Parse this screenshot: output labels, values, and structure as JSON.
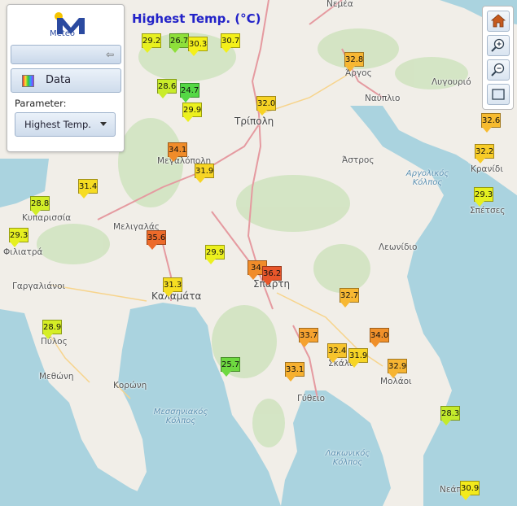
{
  "map": {
    "title": "Highest Temp. (°C)"
  },
  "panel": {
    "logo_text": "Meteo",
    "data_label": "Data",
    "parameter_label": "Parameter:",
    "parameter_value": "Highest Temp."
  },
  "places": [
    {
      "id": "nemea",
      "label": "Νεμέα"
    },
    {
      "id": "argos",
      "label": "Άργος"
    },
    {
      "id": "nafplio",
      "label": "Ναύπλιο"
    },
    {
      "id": "lygourio",
      "label": "Λυγουριό"
    },
    {
      "id": "tripoli",
      "label": "Τρίπολη"
    },
    {
      "id": "astros",
      "label": "Άστρος"
    },
    {
      "id": "megalopoli",
      "label": "Μεγαλόπολη"
    },
    {
      "id": "kyparissia",
      "label": "Κυπαρισσία"
    },
    {
      "id": "meligalas",
      "label": "Μελιγαλάς"
    },
    {
      "id": "filiatra",
      "label": "Φιλιατρά"
    },
    {
      "id": "gargalianoi",
      "label": "Γαργαλιάνοι"
    },
    {
      "id": "kalamata",
      "label": "Καλαμάτα"
    },
    {
      "id": "sparti",
      "label": "Σπάρτη"
    },
    {
      "id": "leonidio",
      "label": "Λεωνίδιο"
    },
    {
      "id": "pylos",
      "label": "Πύλος"
    },
    {
      "id": "methoni",
      "label": "Μεθώνη"
    },
    {
      "id": "koroni",
      "label": "Κορώνη"
    },
    {
      "id": "skala",
      "label": "Σκάλα"
    },
    {
      "id": "molaoi",
      "label": "Μολάοι"
    },
    {
      "id": "gytheio",
      "label": "Γύθειο"
    },
    {
      "id": "kranidi",
      "label": "Κρανίδι"
    },
    {
      "id": "spetses",
      "label": "Σπέτσες"
    },
    {
      "id": "neapoli",
      "label": "Νεάπ"
    },
    {
      "id": "argolikos",
      "label": "Αργολικός Κόλπος"
    },
    {
      "id": "messiniakos",
      "label": "Μεσσηνιακός Κόλπος"
    },
    {
      "id": "lakonikos",
      "label": "Λακωνικός Κόλπος"
    }
  ],
  "markers": [
    {
      "value": "29.2",
      "color": "#e8f020"
    },
    {
      "value": "26.7",
      "color": "#8ee03a"
    },
    {
      "value": "30.3",
      "color": "#f4f01a"
    },
    {
      "value": "30.7",
      "color": "#f4f01a"
    },
    {
      "value": "32.8",
      "color": "#f7b733"
    },
    {
      "value": "28.6",
      "color": "#c9ec2a"
    },
    {
      "value": "24.7",
      "color": "#55d845"
    },
    {
      "value": "29.9",
      "color": "#ecf01e"
    },
    {
      "value": "32.0",
      "color": "#f7d325"
    },
    {
      "value": "32.6",
      "color": "#f7bb30"
    },
    {
      "value": "34.1",
      "color": "#f08c2a"
    },
    {
      "value": "32.2",
      "color": "#f7cc28"
    },
    {
      "value": "31.9",
      "color": "#f7d525"
    },
    {
      "value": "31.4",
      "color": "#f6dc22"
    },
    {
      "value": "28.8",
      "color": "#d2ee28"
    },
    {
      "value": "29.3",
      "color": "#e6f020"
    },
    {
      "value": "29.3",
      "color": "#e6f020"
    },
    {
      "value": "35.6",
      "color": "#ec6a2a"
    },
    {
      "value": "29.9",
      "color": "#ecf01e"
    },
    {
      "value": "31.3",
      "color": "#f6de22"
    },
    {
      "value": "34.",
      "color": "#f08c2a"
    },
    {
      "value": "36.2",
      "color": "#e8562a"
    },
    {
      "value": "32.7",
      "color": "#f7b833"
    },
    {
      "value": "28.9",
      "color": "#d6ee26"
    },
    {
      "value": "33.7",
      "color": "#f5a230"
    },
    {
      "value": "34.0",
      "color": "#f0902a"
    },
    {
      "value": "32.4",
      "color": "#f7c42c"
    },
    {
      "value": "31.9",
      "color": "#f7d525"
    },
    {
      "value": "25.7",
      "color": "#6ed940"
    },
    {
      "value": "33.1",
      "color": "#f6b030"
    },
    {
      "value": "32.9",
      "color": "#f6b432"
    },
    {
      "value": "28.3",
      "color": "#c4ea2c"
    },
    {
      "value": "30.9",
      "color": "#f3ea1c"
    }
  ]
}
